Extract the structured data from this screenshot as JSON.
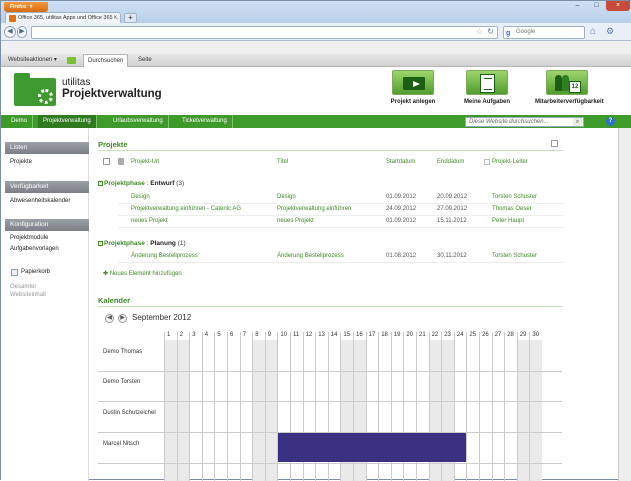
{
  "browser": {
    "app_button": "Firefox",
    "tab_title": "Office 365, utilitas Apps und Office 365 ...",
    "new_tab": "+",
    "search_placeholder": "Google"
  },
  "ribbon": {
    "site_actions": "Websiteaktionen",
    "browse_tab": "Durchsuchen",
    "page_tab": "Seite"
  },
  "header": {
    "brand_line1": "utilitas",
    "brand_line2": "Projektverwaltung",
    "buttons": [
      "Projekt anlegen",
      "Meine Aufgaben",
      "Mitarbeiterverfügbarkeit"
    ],
    "calendar_icon_number": "12"
  },
  "topnav": {
    "items": [
      "Demo",
      "Projektverwaltung",
      "Urlaubsverwaltung",
      "Ticketverwaltung"
    ],
    "search_placeholder": "Diese Website durchsuchen...",
    "help": "?"
  },
  "sidebar": {
    "lists_header": "Listen",
    "lists": [
      "Projekte"
    ],
    "avail_header": "Verfügbarkeit",
    "avail": [
      "Abwesenheitskalender"
    ],
    "config_header": "Konfiguration",
    "config": [
      "Projektmodule",
      "Aufgabenvorlagen"
    ],
    "recycle": "Papierkorb",
    "all_content_1": "Gesamter",
    "all_content_2": "Websiteinhalt"
  },
  "projects": {
    "title": "Projekte",
    "columns": [
      "Projekt-Url",
      "Titel",
      "Startdatum",
      "Enddatum",
      "Projekt-Leiter"
    ],
    "groups": [
      {
        "label": "Projektphase",
        "value": "Entwurf",
        "count": "(3)",
        "rows": [
          [
            "Design",
            "Design",
            "01.09.2012",
            "20.09.2012",
            "Torsten Schuster"
          ],
          [
            "Projektverwaltung einführen - Catenic AG",
            "Projektverwaltung einführen",
            "24.09.2012",
            "27.09.2012",
            "Thomas Oeser"
          ],
          [
            "neues Projekt",
            "neues Projekt",
            "01.09.2012",
            "15.11.2012",
            "Peter Haupt"
          ]
        ]
      },
      {
        "label": "Projektphase",
        "value": "Planung",
        "count": "(1)",
        "rows": [
          [
            "Änderung Bestellprozess",
            "Änderung Bestellprozess",
            "01.08.2012",
            "30.11.2012",
            "Torsten Schuster"
          ]
        ]
      }
    ],
    "add_new": "Neues Element hinzufügen"
  },
  "calendar": {
    "title": "Kalender",
    "month": "September 2012",
    "days": [
      "1",
      "2",
      "3",
      "4",
      "5",
      "6",
      "7",
      "8",
      "9",
      "10",
      "11",
      "12",
      "13",
      "14",
      "15",
      "16",
      "17",
      "18",
      "19",
      "20",
      "21",
      "22",
      "23",
      "24",
      "25",
      "26",
      "27",
      "28",
      "29",
      "30"
    ],
    "weekend_days": [
      1,
      2,
      8,
      9,
      15,
      16,
      22,
      23,
      29,
      30
    ],
    "people": [
      "Demo Thomas",
      "Demo Torsten",
      "Dustin Schutzeichel",
      "Marcel Nitsch"
    ],
    "absences": [
      {
        "person": "Marcel Nitsch",
        "from_day": 10,
        "to_day": 24
      }
    ],
    "absence_color": "#3b3183"
  },
  "colors": {
    "accent": "#3f9a2c",
    "firefox": "#e3781a"
  }
}
